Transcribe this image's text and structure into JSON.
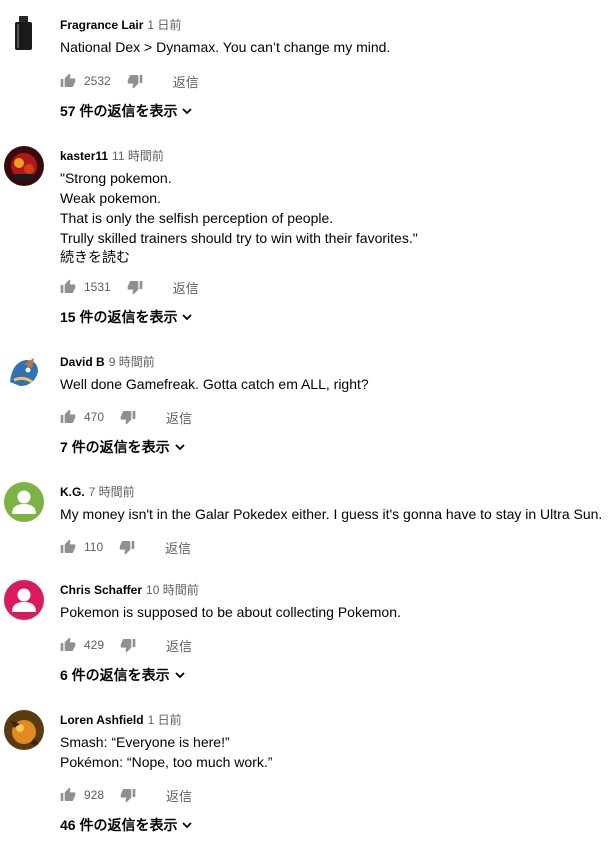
{
  "comments": [
    {
      "author": "Fragrance Lair",
      "time": "1 日前",
      "lines": [
        "National Dex > Dynamax. You can’t change my mind."
      ],
      "likes": "2532",
      "reply": "返信",
      "replies": "57 件の返信を表示",
      "avatar": "bottle"
    },
    {
      "author": "kaster11",
      "time": "11 時間前",
      "lines": [
        "\"Strong pokemon.",
        "Weak pokemon.",
        "That is only the selfish perception of people.",
        "Trully skilled trainers should try to win with their favorites.\""
      ],
      "read_more": "続きを読む",
      "likes": "1531",
      "reply": "返信",
      "replies": "15 件の返信を表示",
      "avatar": "red"
    },
    {
      "author": "David B",
      "time": "9 時間前",
      "lines": [
        "Well done Gamefreak. Gotta catch em ALL, right?"
      ],
      "likes": "470",
      "reply": "返信",
      "replies": "7 件の返信を表示",
      "avatar": "blue"
    },
    {
      "author": "K.G.",
      "time": "7 時間前",
      "lines": [
        "My money isn't in the Galar Pokedex either. I guess it's gonna have to stay in Ultra Sun."
      ],
      "likes": "110",
      "reply": "返信",
      "avatar": "green"
    },
    {
      "author": "Chris Schaffer",
      "time": "10 時間前",
      "lines": [
        "Pokemon is supposed to be about collecting Pokemon."
      ],
      "likes": "429",
      "reply": "返信",
      "replies": "6 件の返信を表示",
      "avatar": "pink"
    },
    {
      "author": "Loren Ashfield",
      "time": "1 日前",
      "lines": [
        "Smash: “Everyone is here!”",
        "Pokémon: “Nope, too much work.”"
      ],
      "likes": "928",
      "reply": "返信",
      "replies": "46 件の返信を表示",
      "avatar": "orange"
    }
  ],
  "colors": {
    "text": "#030303",
    "meta": "#606060",
    "icon": "#909090"
  }
}
